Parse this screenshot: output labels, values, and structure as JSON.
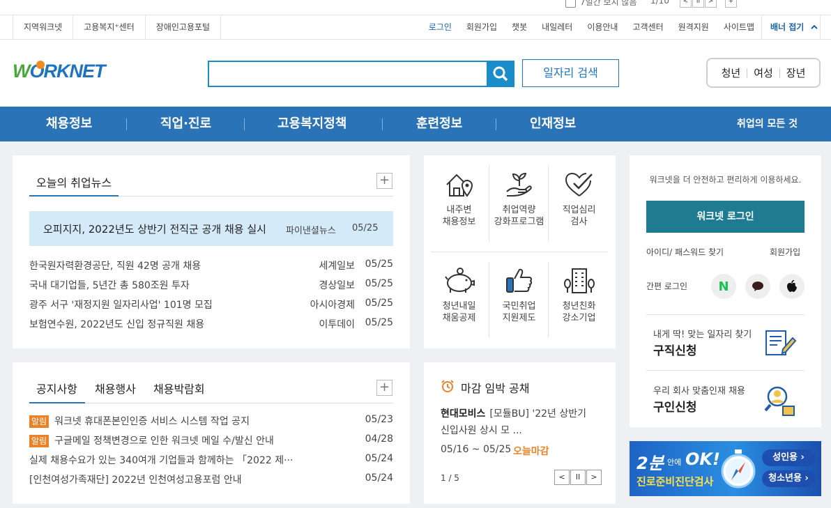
{
  "banner_bar": {
    "hide_today_label": "7일간 보지 않음",
    "pager": "1/10",
    "prev": "<",
    "pause": "II",
    "next": ">",
    "plus": "+"
  },
  "util_left": [
    "지역워크넷",
    "고용복지⁺센터",
    "장애인고용포털"
  ],
  "util_right": [
    {
      "label": "로그인",
      "accent": true
    },
    {
      "label": "회원가입",
      "accent": false
    },
    {
      "label": "챗봇",
      "accent": false
    },
    {
      "label": "내일레터",
      "accent": false
    },
    {
      "label": "이용안내",
      "accent": false
    },
    {
      "label": "고객센터",
      "accent": false
    },
    {
      "label": "원격지원",
      "accent": false
    },
    {
      "label": "사이트맵",
      "accent": false
    }
  ],
  "banner_fold": "배너 접기",
  "logo": {
    "w": "W",
    "rest": "ORKNET"
  },
  "search": {
    "placeholder": "",
    "job_search": "일자리 검색"
  },
  "audience": [
    "청년",
    "여성",
    "장년"
  ],
  "gnb": {
    "items": [
      "채용정보",
      "직업·진로",
      "고용복지정책",
      "훈련정보",
      "인재정보"
    ],
    "all": "취업의 모든 것"
  },
  "news": {
    "tab": "오늘의 취업뉴스",
    "plus": "+",
    "headline": {
      "title": "오피지지, 2022년도 상반기 전직군 공개 채용 실시",
      "source": "파이낸셜뉴스",
      "date": "05/25"
    },
    "items": [
      {
        "title": "한국원자력환경공단, 직원 42명 공개 채용",
        "source": "세계일보",
        "date": "05/25"
      },
      {
        "title": "국내 대기업들, 5년간 총 580조원 투자",
        "source": "경상일보",
        "date": "05/25"
      },
      {
        "title": "광주 서구 '재정지원 일자리사업' 101명 모집",
        "source": "아시아경제",
        "date": "05/25"
      },
      {
        "title": "보험연수원, 2022년도 신입 정규직원 채용",
        "source": "이투데이",
        "date": "05/25"
      }
    ]
  },
  "services": [
    {
      "line1": "내주변",
      "line2": "채용정보",
      "icon": "house-pin-icon"
    },
    {
      "line1": "취업역량",
      "line2": "강화프로그램",
      "icon": "sprout-hand-icon"
    },
    {
      "line1": "직업심리",
      "line2": "검사",
      "icon": "heart-check-icon"
    },
    {
      "line1": "청년내일",
      "line2": "채움공제",
      "icon": "piggy-bank-icon"
    },
    {
      "line1": "국민취업",
      "line2": "지원제도",
      "icon": "thumbs-up-icon"
    },
    {
      "line1": "청년친화",
      "line2": "강소기업",
      "icon": "building-icon"
    }
  ],
  "login": {
    "intro": "워크넷을 더 안전하고 편리하게 이용하세요.",
    "button": "워크넷 로그인",
    "find": "아이디/ 패스워드 찾기",
    "join": "회원가입",
    "simple": "간편 로그인",
    "naver": "N",
    "kakao_icon": "speech-bubble-icon",
    "apple_icon": "apple-icon"
  },
  "apply": [
    {
      "small": "내게 딱! 맞는 일자리 찾기",
      "big": "구직신청",
      "icon": "form-pen-icon"
    },
    {
      "small": "우리 회사 맞춤인재 채용",
      "big": "구인신청",
      "icon": "magnifier-person-icon"
    }
  ],
  "notices": {
    "tabs": [
      "공지사항",
      "채용행사",
      "채용박람회"
    ],
    "plus": "+",
    "items": [
      {
        "badge": "알림",
        "title": "워크넷 휴대폰본인인증 서비스 시스템 작업 공지",
        "date": "05/23"
      },
      {
        "badge": "알림",
        "title": "구글메일 정책변경으로 인한 워크넷 메일 수/발신 안내",
        "date": "04/28"
      },
      {
        "badge": "",
        "title": "실제 채용수요가 있는 340여개 기업들과 함께하는 「2022 제···",
        "date": "05/24"
      },
      {
        "badge": "",
        "title": "[인천여성가족재단] 2022년 인천여성고용포럼 안내",
        "date": "05/24"
      }
    ]
  },
  "deadline": {
    "title": "마감 임박 공채",
    "company": "현대모비스",
    "desc1": "[모듈BU] '22년 상반기",
    "desc2": "신입사원 상시 모 ...",
    "period": "05/16 ~ 05/25",
    "today": "오늘마감",
    "pager": "1 / 5",
    "prev": "<",
    "pause": "II",
    "next": ">"
  },
  "ad": {
    "big": "2분",
    "mid": "안에",
    "ok": "OK!",
    "sub": "진로준비진단검사",
    "btn1": "성인용 ›",
    "btn2": "청소년용 ›"
  },
  "colors": {
    "brand_blue": "#2a73b6",
    "search_blue": "#1a8cca",
    "login_teal": "#1f7b92",
    "accent_orange": "#e8832a"
  }
}
